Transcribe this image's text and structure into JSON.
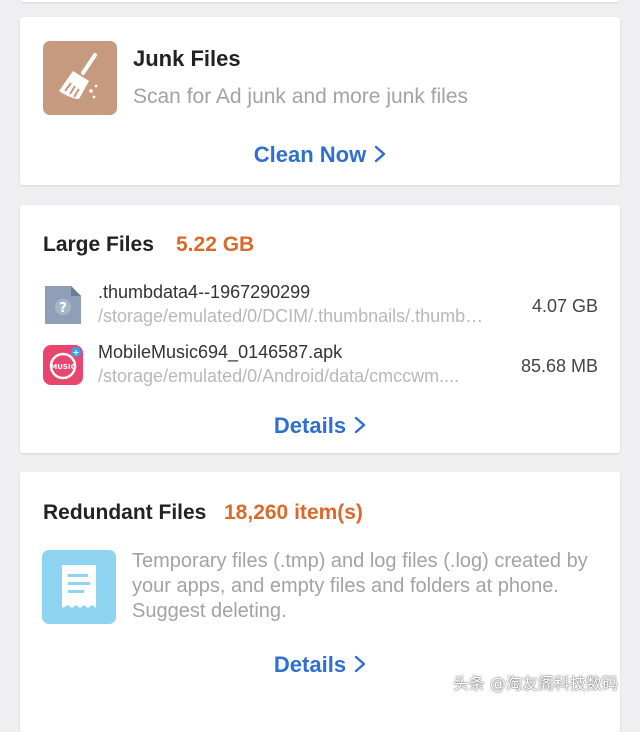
{
  "junk_files": {
    "icon": "broom-icon",
    "title": "Junk Files",
    "description": "Scan for Ad junk and more junk files",
    "action_label": "Clean Now",
    "action_icon": "chevron-right-icon"
  },
  "large_files": {
    "title": "Large Files",
    "total_size": "5.22 GB",
    "files": [
      {
        "icon": "unknown-file-icon",
        "name": ".thumbdata4--1967290299",
        "path": "/storage/emulated/0/DCIM/.thumbnails/.thumb…",
        "size": "4.07 GB"
      },
      {
        "icon": "music-app-icon",
        "icon_label": "MUSIC",
        "name": "MobileMusic694_0146587.apk",
        "path": "/storage/emulated/0/Android/data/cmccwm....",
        "size": "85.68 MB"
      }
    ],
    "action_label": "Details",
    "action_icon": "chevron-right-icon"
  },
  "redundant_files": {
    "title": "Redundant Files",
    "count": "18,260 item(s)",
    "icon": "document-icon",
    "description": "Temporary files (.tmp) and log files (.log) created by your apps, and empty files and folders at phone. Suggest deleting.",
    "action_label": "Details",
    "action_icon": "chevron-right-icon"
  },
  "watermark": "头条 @淘友阁科技数码",
  "colors": {
    "background": "#efeff1",
    "card": "#ffffff",
    "accent_blue": "#2f6fd2",
    "accent_orange": "#d96a2c",
    "junk_icon_bg": "#c69a7f",
    "doc_icon_bg": "#8ed3f0",
    "music_icon_bg": "#e8456f",
    "secondary_text": "#a3a3a3"
  }
}
